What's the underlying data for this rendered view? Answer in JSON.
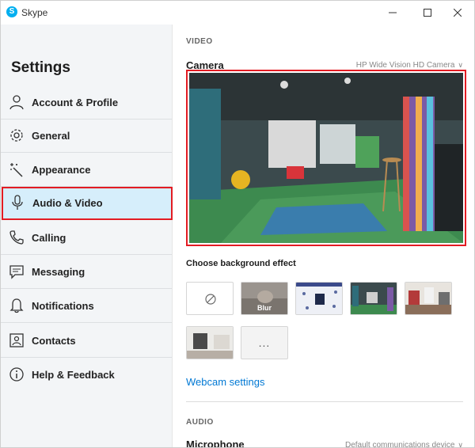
{
  "window": {
    "app_title": "Skype",
    "logo_letter": "S",
    "brand_color": "#00aff0"
  },
  "sidebar": {
    "title": "Settings",
    "items": [
      {
        "label": "Account & Profile",
        "icon": "person-icon"
      },
      {
        "label": "General",
        "icon": "gear-icon"
      },
      {
        "label": "Appearance",
        "icon": "magic-wand-icon"
      },
      {
        "label": "Audio & Video",
        "icon": "microphone-icon",
        "active": true
      },
      {
        "label": "Calling",
        "icon": "phone-icon"
      },
      {
        "label": "Messaging",
        "icon": "chat-bubble-icon"
      },
      {
        "label": "Notifications",
        "icon": "bell-icon"
      },
      {
        "label": "Contacts",
        "icon": "contact-card-icon"
      },
      {
        "label": "Help & Feedback",
        "icon": "info-icon"
      }
    ],
    "active_highlight_color": "#d6eefb",
    "annotation_color": "#e31c23"
  },
  "main": {
    "video_heading": "VIDEO",
    "camera_label": "Camera",
    "camera_value": "HP Wide Vision HD Camera",
    "background_label": "Choose background effect",
    "tiles": [
      {
        "name": "none",
        "caption": ""
      },
      {
        "name": "blur",
        "caption": "Blur"
      },
      {
        "name": "pattern",
        "caption": ""
      },
      {
        "name": "office-teal",
        "caption": ""
      },
      {
        "name": "office-room",
        "caption": ""
      },
      {
        "name": "room-white",
        "caption": ""
      },
      {
        "name": "more",
        "caption": "..."
      }
    ],
    "webcam_settings": "Webcam settings",
    "audio_heading": "AUDIO",
    "microphone_label": "Microphone",
    "microphone_value": "Default communications device",
    "link_color": "#0078d4"
  }
}
